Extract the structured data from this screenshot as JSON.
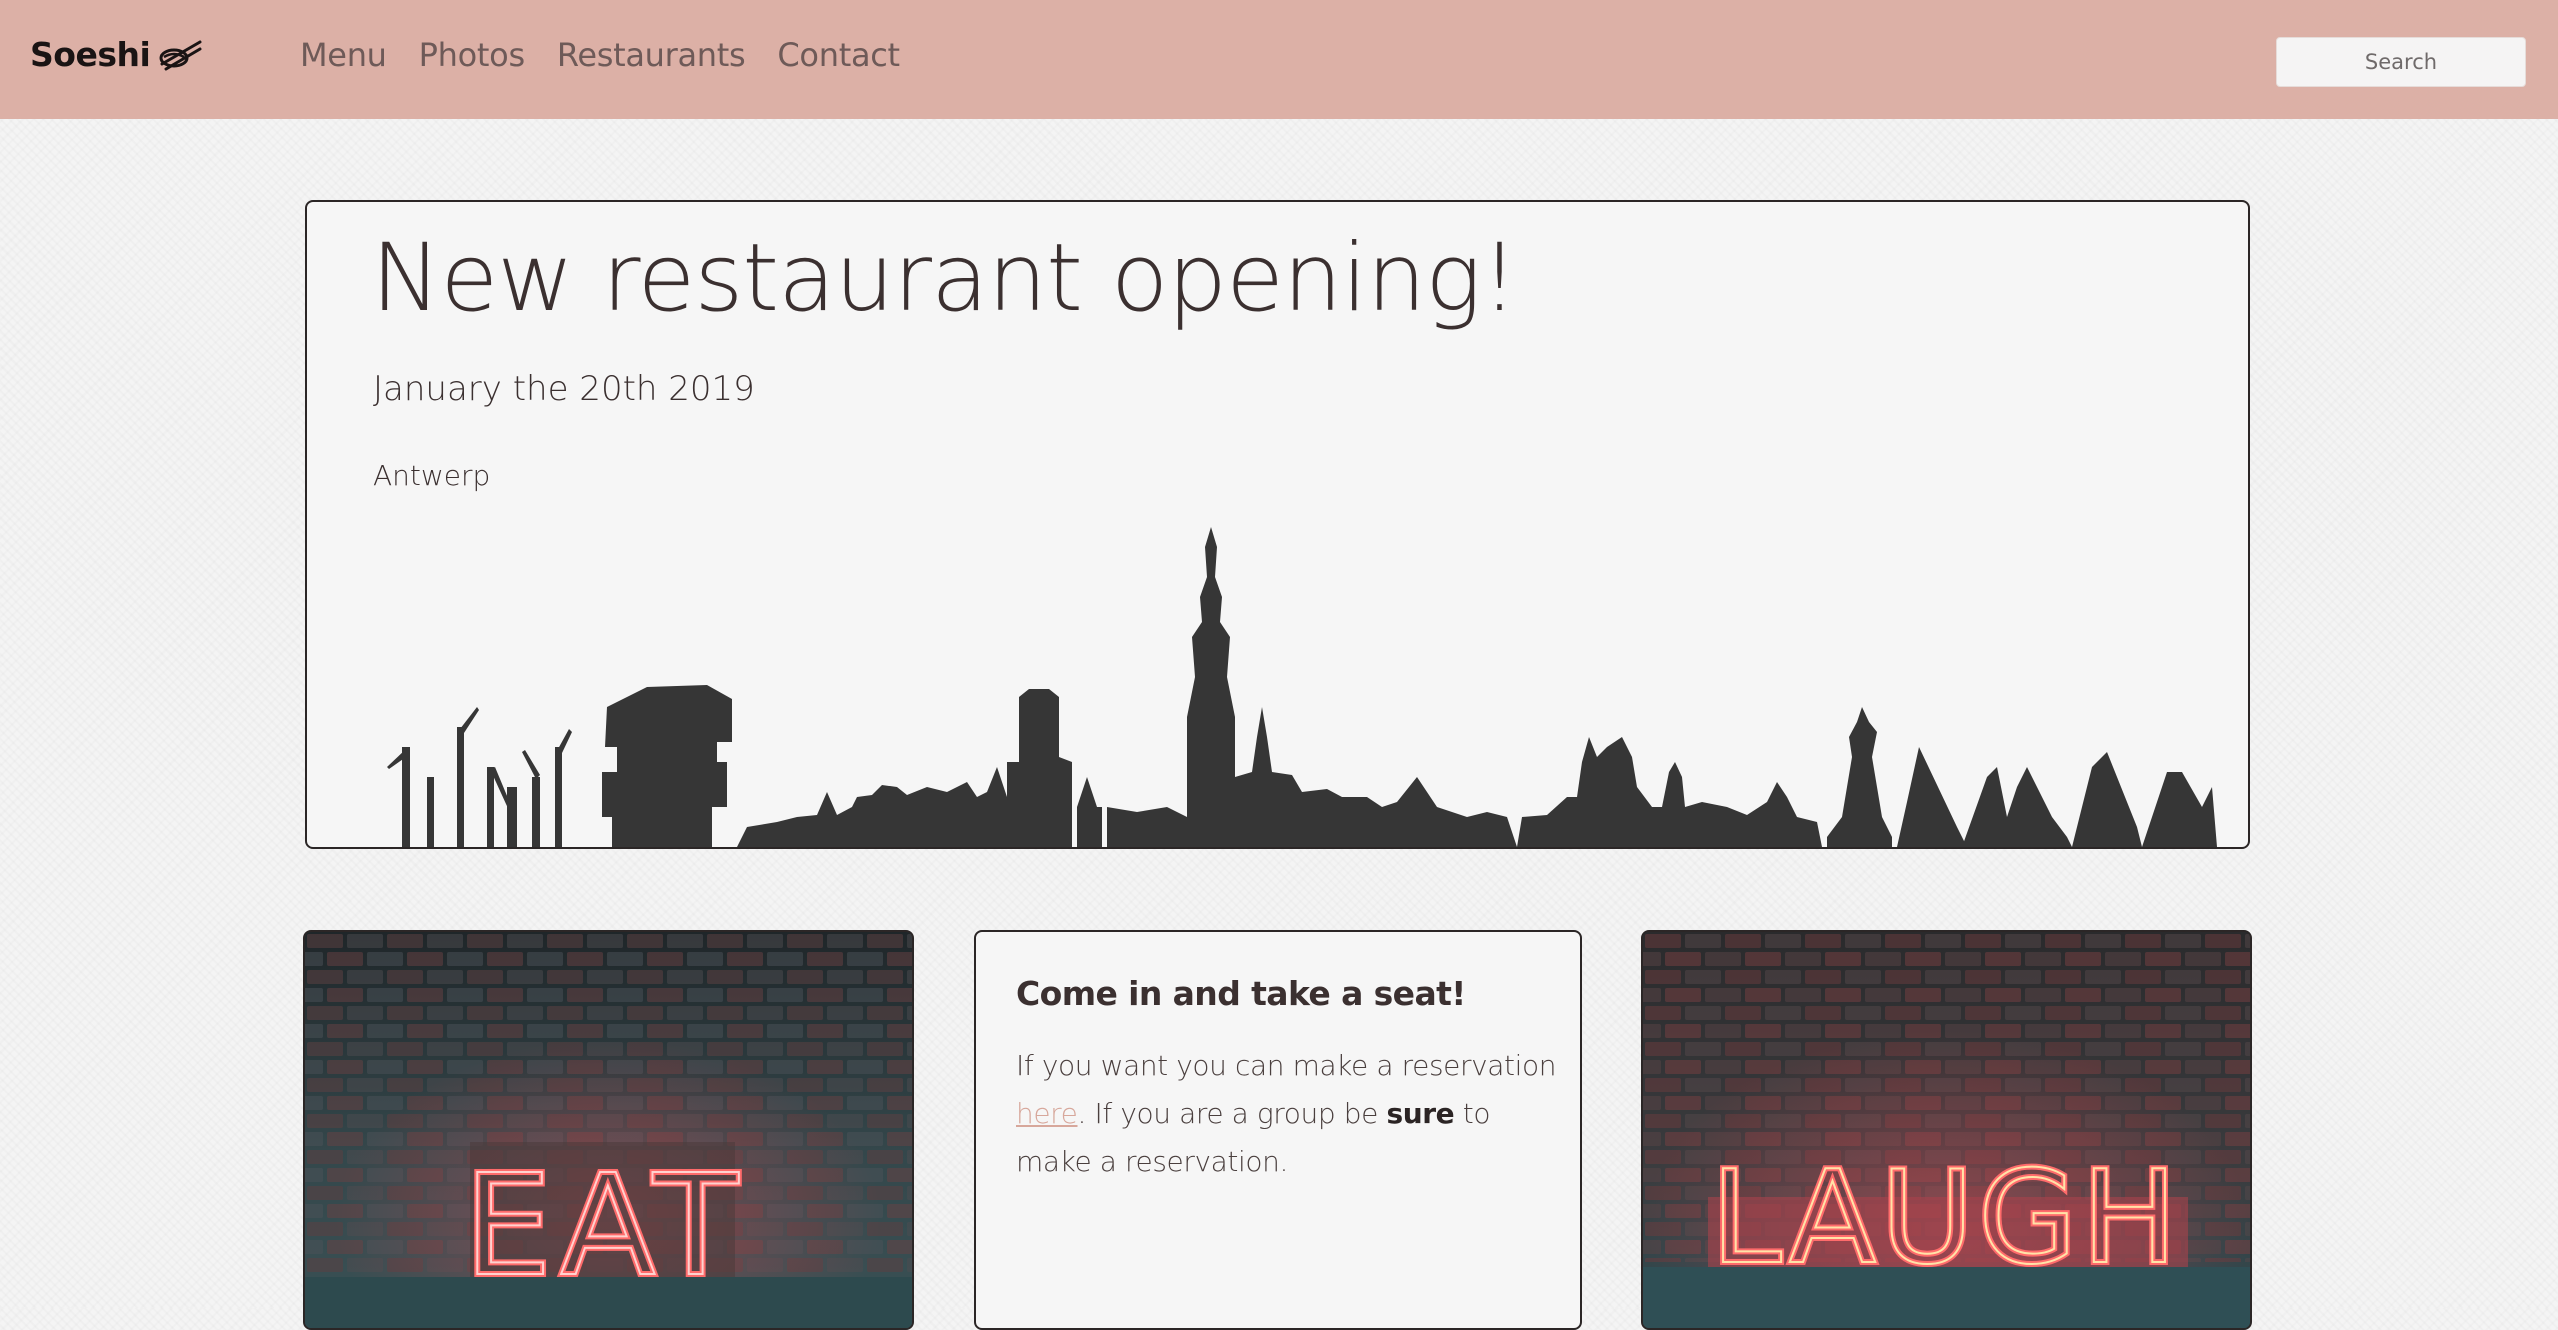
{
  "navbar": {
    "brand": "Soeshi",
    "brand_icon": "chopsticks-sushi-icon",
    "links": [
      "Menu",
      "Photos",
      "Restaurants",
      "Contact"
    ],
    "search_placeholder": "Search",
    "background_color": "#dcb0a6"
  },
  "hero": {
    "title": "New restaurant opening!",
    "date": "January the 20th 2019",
    "city": "Antwerp",
    "illustration": "antwerp-skyline-silhouette"
  },
  "cards": {
    "eat": {
      "image": "neon-sign-eat",
      "sign_text": "EAT"
    },
    "info": {
      "title": "Come in and take a seat!",
      "text_1": "If you want you can make a reservation ",
      "link": "here",
      "text_2": ". If you are a group be ",
      "bold": "sure",
      "text_3": " to make a reservation."
    },
    "laugh": {
      "image": "neon-sign-laugh",
      "sign_text": "LAUGH"
    }
  },
  "colors": {
    "accent": "#dcb0a6",
    "link": "#d7a79b",
    "text": "#3b3030",
    "neon_red": "#ff5a5a"
  }
}
